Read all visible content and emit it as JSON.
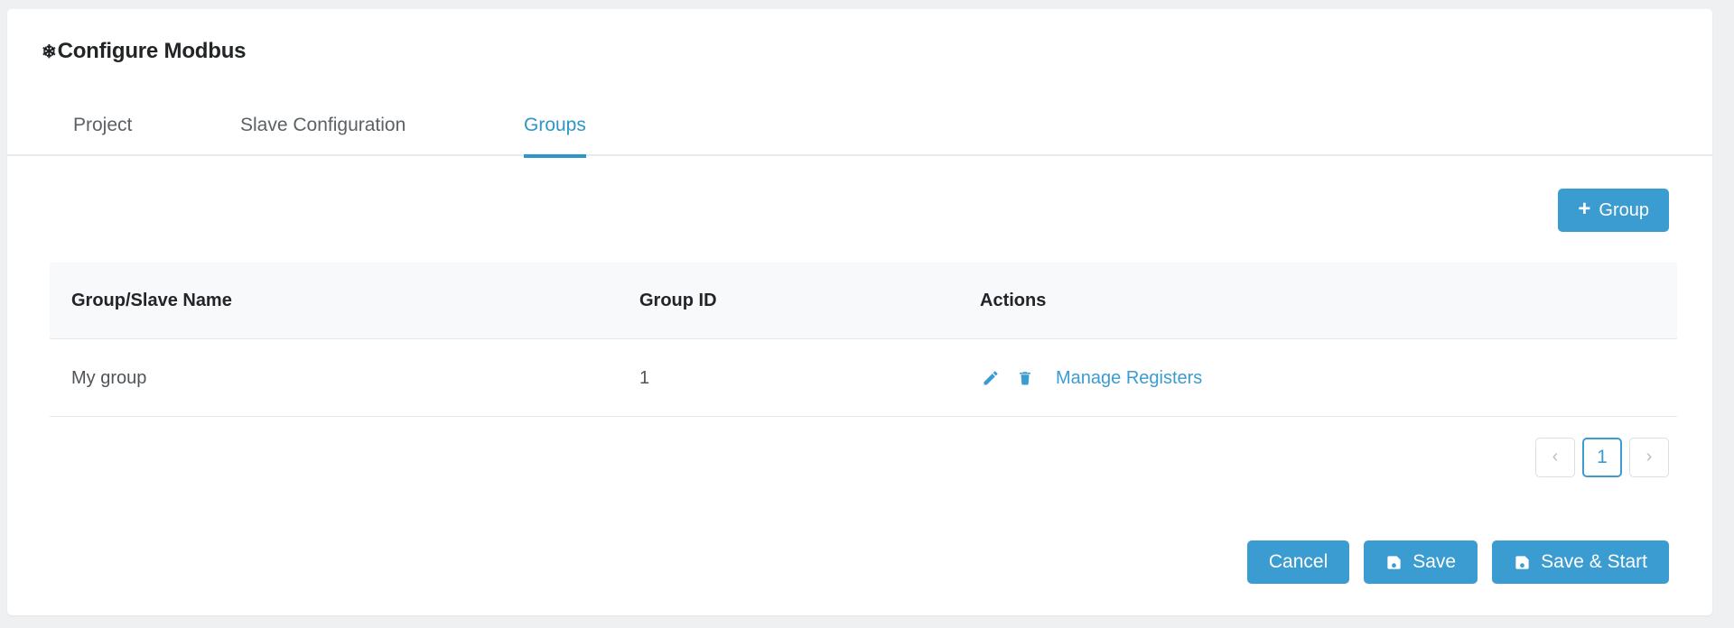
{
  "window": {
    "title": "Configure Modbus",
    "title_icon": "snowflake-icon",
    "accent_color": "#3b9cd1",
    "page_background": "#eef0f2",
    "card_background": "#ffffff"
  },
  "tabs": [
    {
      "label": "Project",
      "active": false
    },
    {
      "label": "Slave Configuration",
      "active": false
    },
    {
      "label": "Groups",
      "active": true
    }
  ],
  "toolbar": {
    "add_group_label": "Group",
    "add_group_icon": "plus-icon"
  },
  "table": {
    "columns": [
      "Group/Slave Name",
      "Group ID",
      "Actions"
    ],
    "rows": [
      {
        "name": "My group",
        "group_id": "1",
        "actions": {
          "edit_icon": "pencil-icon",
          "delete_icon": "trash-icon",
          "manage_link": "Manage Registers"
        }
      }
    ]
  },
  "pagination": {
    "prev_label": "‹",
    "next_label": "›",
    "pages": [
      "1"
    ],
    "current_page": "1"
  },
  "footer": {
    "cancel_label": "Cancel",
    "save_label": "Save",
    "save_start_label": "Save & Start",
    "save_icon": "floppy-disk-icon"
  }
}
